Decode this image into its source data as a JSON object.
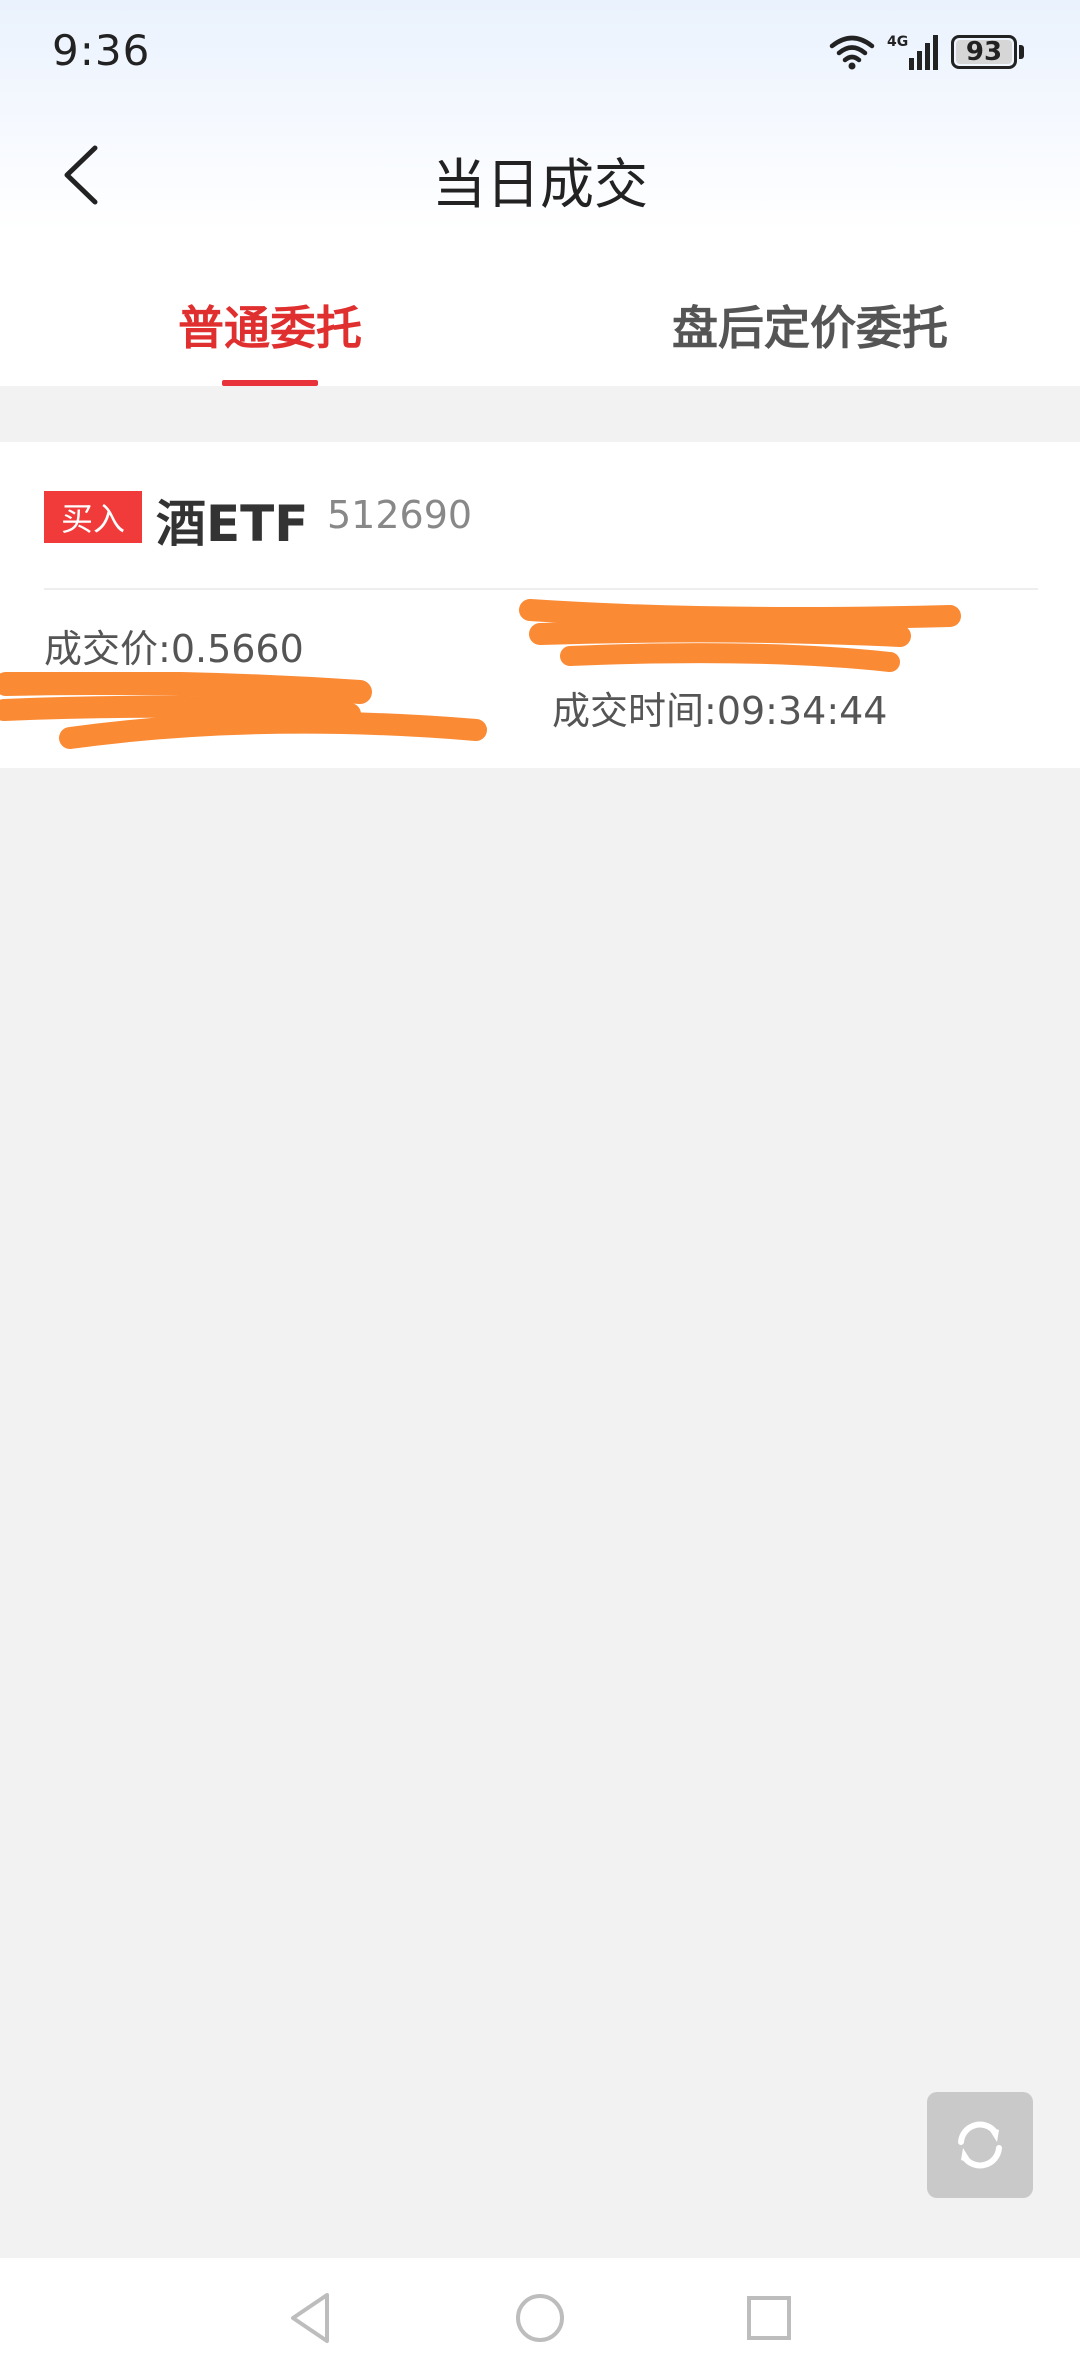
{
  "status_bar": {
    "time": "9:36",
    "network": "4G",
    "battery": "93"
  },
  "header": {
    "title": "当日成交"
  },
  "tabs": [
    {
      "label": "普通委托",
      "active": true
    },
    {
      "label": "盘后定价委托",
      "active": false
    }
  ],
  "trade": {
    "side": "买入",
    "stock_name": "酒ETF",
    "stock_code": "512690",
    "price_label": "成交价:",
    "price_value": "0.5660",
    "time_label": "成交时间:",
    "time_value": "09:34:44"
  },
  "colors": {
    "accent_red": "#e02f2f",
    "badge_red": "#f13b3b",
    "redaction_orange": "#fb8a35"
  },
  "icons": {
    "back": "chevron-left-icon",
    "refresh": "refresh-icon",
    "nav_back": "triangle-back-icon",
    "nav_home": "circle-home-icon",
    "nav_recent": "square-recent-icon"
  }
}
